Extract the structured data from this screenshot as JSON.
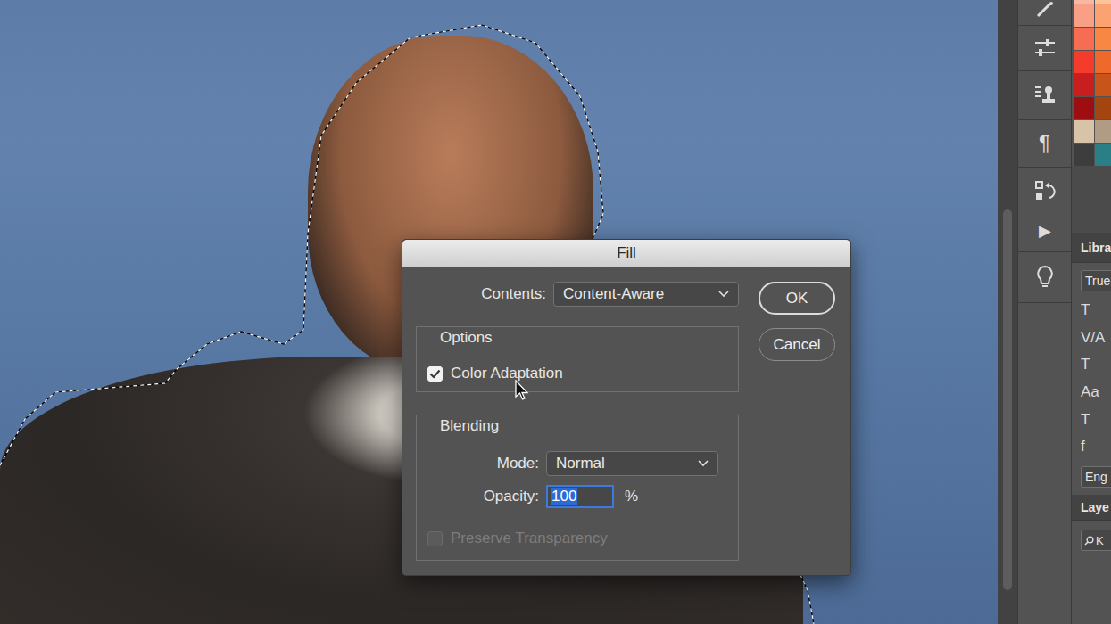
{
  "dialog": {
    "title": "Fill",
    "contents": {
      "label": "Contents:",
      "value": "Content-Aware"
    },
    "options": {
      "legend": "Options",
      "items": [
        {
          "label": "Color Adaptation",
          "checked": true,
          "disabled": false
        }
      ]
    },
    "blending": {
      "legend": "Blending",
      "mode": {
        "label": "Mode:",
        "value": "Normal"
      },
      "opacity": {
        "label": "Opacity:",
        "value": "100",
        "unit": "%",
        "selected": true
      },
      "preserve": {
        "label": "Preserve Transparency",
        "checked": false,
        "disabled": true
      }
    },
    "buttons": [
      {
        "label": "OK",
        "default": true
      },
      {
        "label": "Cancel",
        "default": false
      }
    ]
  },
  "toolbar": {
    "paragraph": "¶",
    "play": "▶"
  },
  "swatches": [
    {
      "color": "#f7b7a3"
    },
    {
      "color": "#fbc49a"
    },
    {
      "color": "#f99f86"
    },
    {
      "color": "#fba273"
    },
    {
      "color": "#f76d52"
    },
    {
      "color": "#f98744"
    },
    {
      "color": "#f53b2b"
    },
    {
      "color": "#ef6a2a"
    },
    {
      "color": "#c81e1e"
    },
    {
      "color": "#c9541a"
    },
    {
      "color": "#9e0d0f"
    },
    {
      "color": "#a4450f"
    },
    {
      "color": "#d6c3a8"
    },
    {
      "color": "#b09c84"
    },
    {
      "color": "#3d3d3d"
    },
    {
      "color": "#2a7f86"
    }
  ],
  "libraries": {
    "tab": "Libra",
    "field": "True"
  },
  "character": {
    "glyphs": [
      "T",
      "V/A",
      "T",
      "Aa",
      "T",
      "f"
    ],
    "language": "Eng"
  },
  "layers": {
    "tab": "Laye",
    "search": "K"
  }
}
